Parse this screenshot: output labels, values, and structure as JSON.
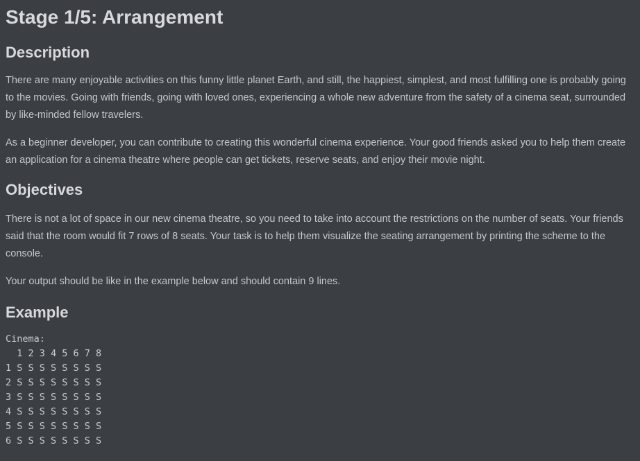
{
  "title": "Stage 1/5: Arrangement",
  "description": {
    "heading": "Description",
    "paragraphs": [
      "There are many enjoyable activities on this funny little planet Earth, and still, the happiest, simplest, and most fulfilling one is probably going to the movies. Going with friends, going with loved ones, experiencing a whole new adventure from the safety of a cinema seat, surrounded by like-minded fellow travelers.",
      "As a beginner developer, you can contribute to creating this wonderful cinema experience. Your good friends asked you to help them create an application for a cinema theatre where people can get tickets, reserve seats, and enjoy their movie night."
    ]
  },
  "objectives": {
    "heading": "Objectives",
    "paragraphs": [
      "There is not a lot of space in our new cinema theatre, so you need to take into account the restrictions on the number of seats. Your friends said that the room would fit 7 rows of 8 seats. Your task is to help them visualize the seating arrangement by printing the scheme to the console.",
      "Your output should be like in the example below and should contain 9 lines."
    ]
  },
  "example": {
    "heading": "Example",
    "code_lines": [
      "Cinema:",
      "  1 2 3 4 5 6 7 8",
      "1 S S S S S S S S",
      "2 S S S S S S S S",
      "3 S S S S S S S S",
      "4 S S S S S S S S",
      "5 S S S S S S S S",
      "6 S S S S S S S S"
    ]
  }
}
